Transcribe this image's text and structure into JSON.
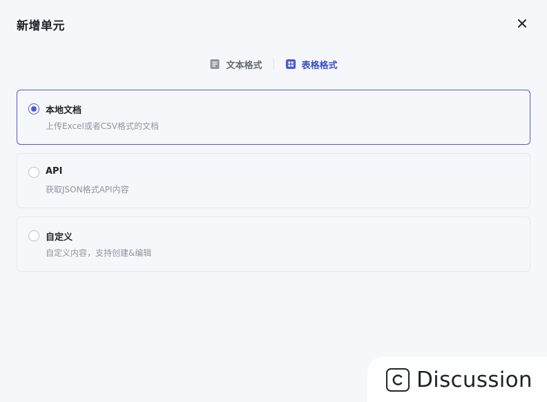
{
  "dialog": {
    "title": "新增单元",
    "close_icon": "close-icon"
  },
  "tabs": [
    {
      "label": "文本格式",
      "icon": "document-icon",
      "active": false
    },
    {
      "label": "表格格式",
      "icon": "table-icon",
      "active": true
    }
  ],
  "options": [
    {
      "title": "本地文档",
      "desc": "上传Excel或者CSV格式的文档",
      "selected": true
    },
    {
      "title": "API",
      "desc": "获取JSON格式API内容",
      "selected": false
    },
    {
      "title": "自定义",
      "desc": "自定义内容，支持创建&编辑",
      "selected": false
    }
  ],
  "badge": {
    "label": "Discussion",
    "icon": "copyright-c-icon"
  },
  "colors": {
    "accent": "#4a5bd4",
    "background": "#f6f7fb",
    "border": "#e6e8ee",
    "muted_text": "#8f959e"
  }
}
